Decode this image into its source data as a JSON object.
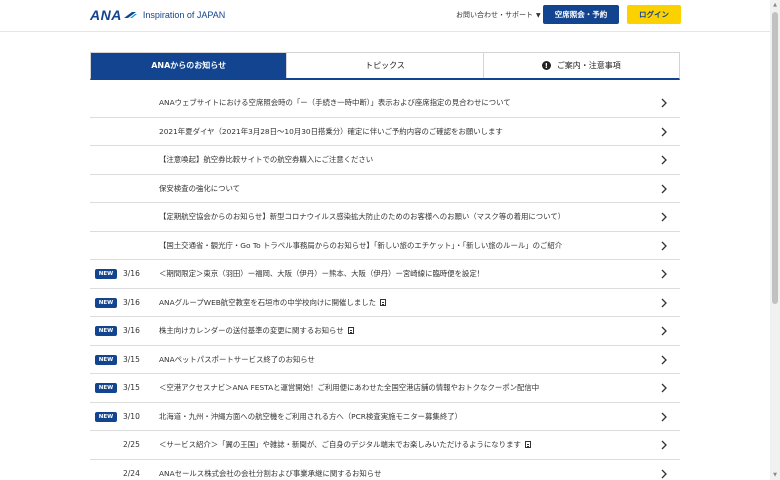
{
  "header": {
    "logo_text": "ANA",
    "tagline": "Inspiration of JAPAN",
    "contact_label": "お問い合わせ・サポート",
    "reservation_button": "空席照会・予約",
    "login_button": "ログイン"
  },
  "tabs": [
    {
      "label": "ANAからのお知らせ"
    },
    {
      "label": "トピックス"
    },
    {
      "label": "ご案内・注意事項"
    }
  ],
  "colors": {
    "brand_blue": "#13448f",
    "login_yellow": "#fbd100"
  },
  "news": [
    {
      "badge": "",
      "date": "",
      "title": "ANAウェブサイトにおける空席照会時の「ー（手続き一時中断）」表示および座席指定の見合わせについて"
    },
    {
      "badge": "",
      "date": "",
      "title": "2021年夏ダイヤ（2021年3月28日〜10月30日搭乗分）確定に伴いご予約内容のご確認をお願いします"
    },
    {
      "badge": "",
      "date": "",
      "title": "【注意喚起】航空券比較サイトでの航空券購入にご注意ください"
    },
    {
      "badge": "",
      "date": "",
      "title": "保安検査の強化について"
    },
    {
      "badge": "",
      "date": "",
      "title": "【定期航空協会からのお知らせ】新型コロナウイルス感染拡大防止のためのお客様へのお願い（マスク等の着用について）"
    },
    {
      "badge": "",
      "date": "",
      "title": "【国土交通省・観光庁・Go To トラベル事務局からのお知らせ】「新しい旅のエチケット」・「新しい旅のルール」のご紹介"
    },
    {
      "badge": "NEW",
      "date": "3/16",
      "title": "＜期間限定＞東京（羽田）ー福岡、大阪（伊丹）ー熊本、大阪（伊丹）ー宮崎線に臨時便を設定！"
    },
    {
      "badge": "NEW",
      "date": "3/16",
      "title": "ANAグループWEB航空教室を石垣市の中学校向けに開催しました",
      "doc": true
    },
    {
      "badge": "NEW",
      "date": "3/16",
      "title": "株主向けカレンダーの送付基準の変更に関するお知らせ",
      "doc": true
    },
    {
      "badge": "NEW",
      "date": "3/15",
      "title": "ANAペットパスポートサービス終了のお知らせ"
    },
    {
      "badge": "NEW",
      "date": "3/15",
      "title": "＜空港アクセスナビ＞ANA FESTAと運営開始！ご利用便にあわせた全国空港店舗の情報やおトクなクーポン配信中"
    },
    {
      "badge": "NEW",
      "date": "3/10",
      "title": "北海道・九州・沖縄方面への航空機をご利用される方へ（PCR検査実施モニター募集終了）"
    },
    {
      "badge": "",
      "date": "2/25",
      "title": "＜サービス紹介＞「翼の王国」や雑誌・新聞が、ご自身のデジタル端末でお楽しみいただけるようになります",
      "doc": true
    },
    {
      "badge": "",
      "date": "2/24",
      "title": "ANAセールス株式会社の会社分割および事業承継に関するお知らせ"
    }
  ]
}
